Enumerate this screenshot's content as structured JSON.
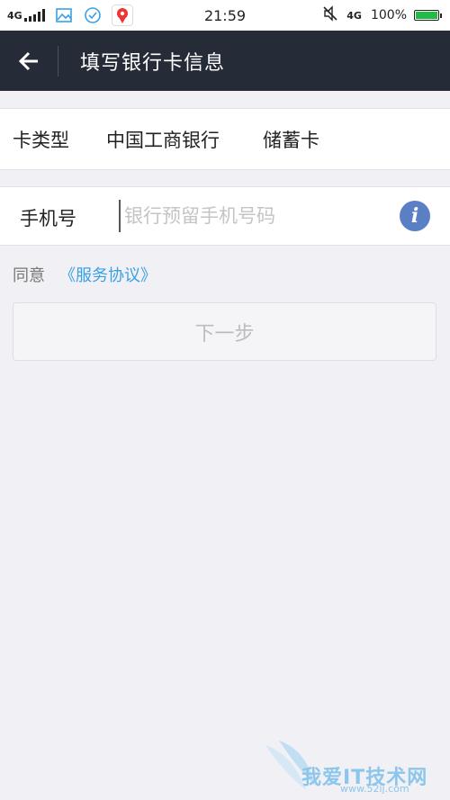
{
  "status_bar": {
    "network": "4G",
    "time": "21:59",
    "network_right": "4G",
    "battery": "100%",
    "icons": [
      "signal-icon",
      "gallery-icon",
      "check-circle-icon",
      "du-app-icon",
      "mute-icon",
      "battery-icon"
    ]
  },
  "header": {
    "title": "填写银行卡信息",
    "back_icon": "back-arrow-icon"
  },
  "card_info": {
    "label": "卡类型",
    "bank": "中国工商银行",
    "type": "储蓄卡"
  },
  "phone": {
    "label": "手机号",
    "placeholder": "银行预留手机号码",
    "value": "",
    "info_icon": "info-icon"
  },
  "agreement": {
    "prefix": "同意",
    "link": "《服务协议》"
  },
  "next_button": {
    "label": "下一步"
  },
  "watermark": {
    "text": "我爱IT技术网",
    "sub": "www.52ij.com"
  },
  "colors": {
    "header_bg": "#262b38",
    "page_bg": "#f0f0f5",
    "link": "#3aa0e6",
    "info": "#5b7fc4",
    "battery": "#22bb44"
  }
}
